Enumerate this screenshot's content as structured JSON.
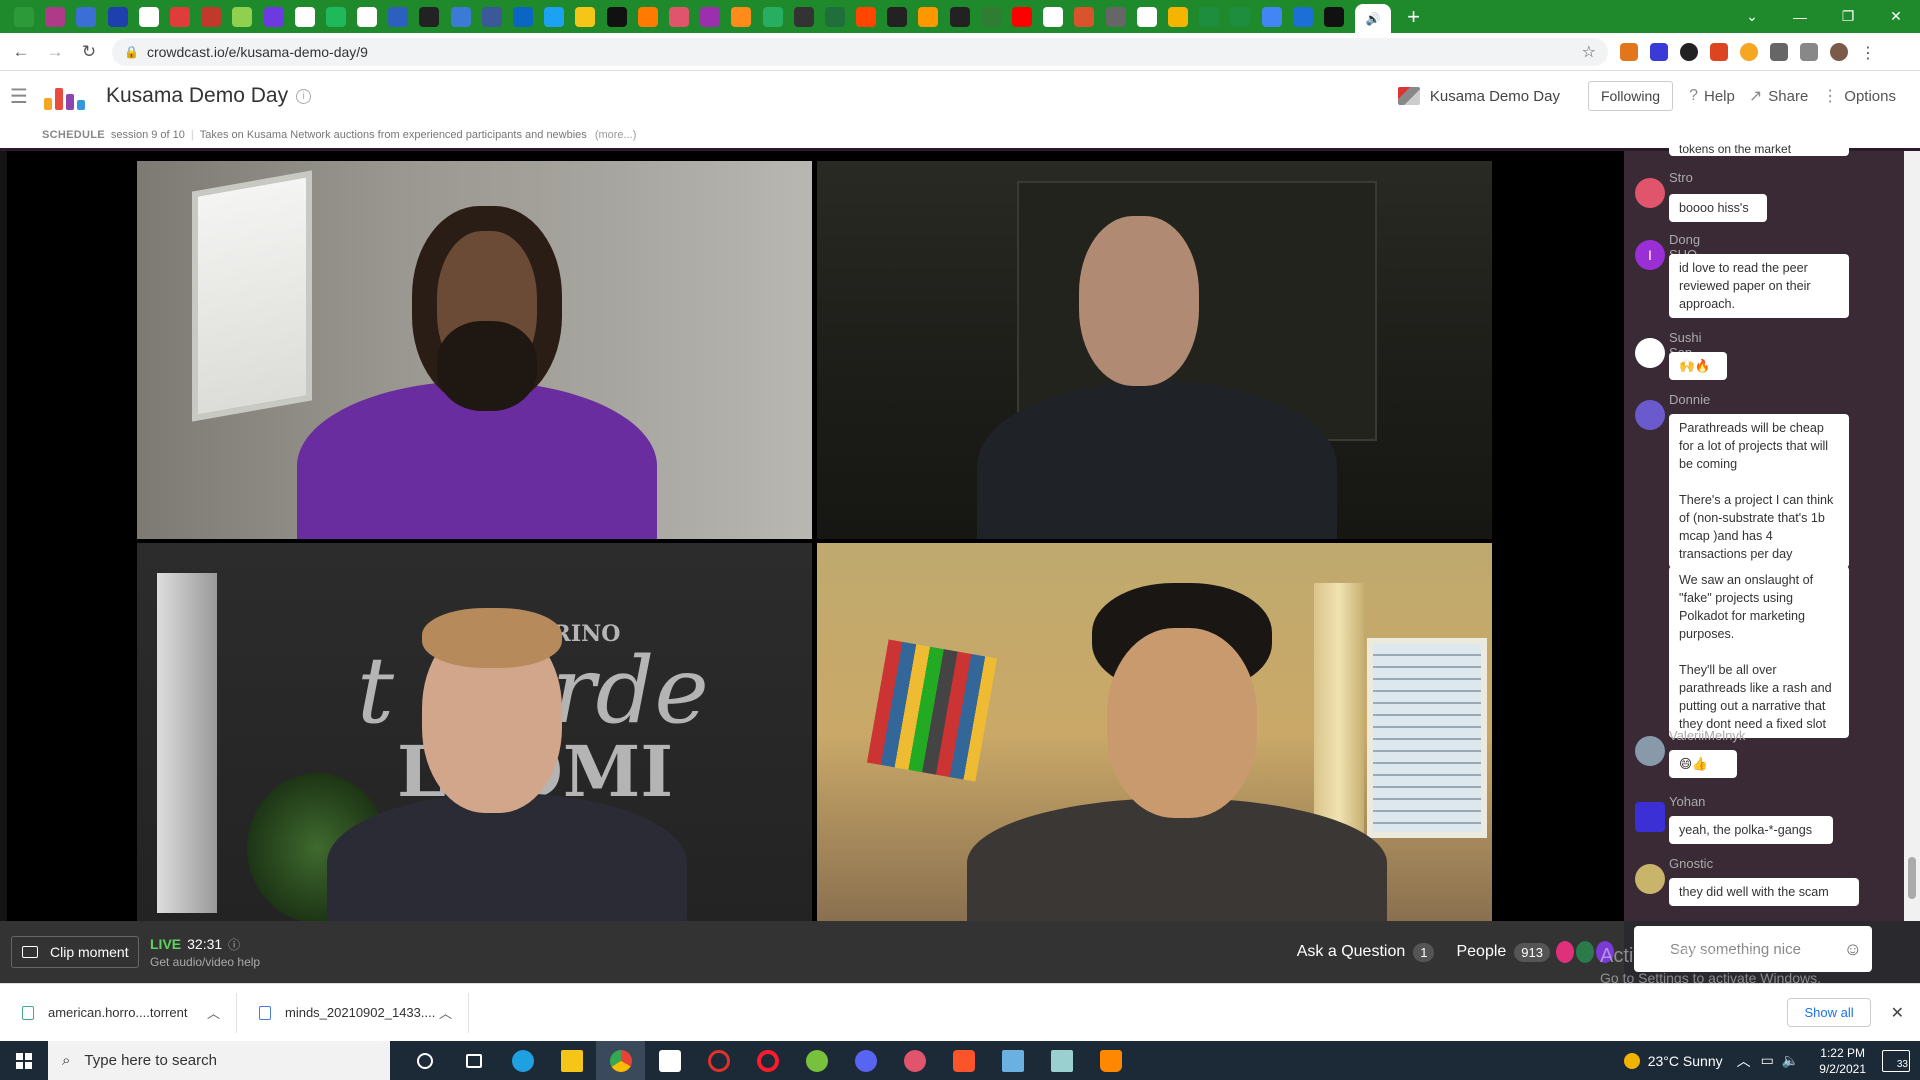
{
  "browser": {
    "url": "crowdcast.io/e/kusama-demo-day/9",
    "tab_colors": [
      "#2d9a3a",
      "#b03a8a",
      "#3b6fd6",
      "#1e3fae",
      "#ffffff",
      "#e03c3c",
      "#c0392b",
      "#8fd14f",
      "#6c3ae0",
      "#ffffff",
      "#1fb85a",
      "#ffffff",
      "#2d5fbf",
      "#222222",
      "#3b7bd6",
      "#3b5998",
      "#0a66c2",
      "#1da1f2",
      "#f5c518",
      "#111111",
      "#ff7a00",
      "#e0556b",
      "#9b2fae",
      "#ff8c1a",
      "#27ae60",
      "#333333",
      "#1f6f3a",
      "#ff4500",
      "#222222",
      "#ff9800",
      "#222222",
      "#2e7d32",
      "#ff0000",
      "#ffffff",
      "#d9532c",
      "#666666",
      "#ffffff",
      "#f4b400",
      "#1e8e3e",
      "#1e8e3e",
      "#4285f4",
      "#1b6fd6",
      "#111111"
    ]
  },
  "header": {
    "title": "Kusama Demo Day",
    "event_name": "Kusama Demo Day",
    "following_label": "Following",
    "help_label": "Help",
    "share_label": "Share",
    "options_label": "Options"
  },
  "schedule": {
    "label": "SCHEDULE",
    "session": "session 9 of 10",
    "description": "Takes on Kusama Network auctions from experienced participants and newbies",
    "more": "(more...)"
  },
  "video": {
    "chalk_text_top": "TORINO",
    "chalk_text_main": "t Garde",
    "chalk_text_bottom": "LCOMI"
  },
  "bottom_bar": {
    "clip_label": "Clip moment",
    "live_label": "LIVE",
    "live_time": "32:31",
    "av_help": "Get audio/video help",
    "ask_label": "Ask a Question",
    "ask_count": "1",
    "people_label": "People",
    "people_count": "913"
  },
  "chat": {
    "partial_text": "tokens on the market",
    "messages": [
      {
        "name": "Stro",
        "text": "boooo hiss's",
        "color": "#e0556b"
      },
      {
        "name": "Dong SHO",
        "text": "id love to read the peer reviewed paper on their approach.",
        "color": "#9b2fd6",
        "initial": "I"
      },
      {
        "name": "Sushi San",
        "text": "🙌🔥",
        "color": "#ffffff"
      },
      {
        "name": "Donnie",
        "text": "Parathreads will be cheap for a lot of projects that will be coming\n\nThere's a project I can think of (non-substrate that's 1b mcap )and has 4 transactions per day",
        "color": "#6a5acd"
      },
      {
        "name": "",
        "text": "We saw an onslaught of \"fake\" projects using Polkadot for marketing purposes.\n\nThey'll be all over parathreads like a rash and putting out a narrative that they dont need a fixed slot",
        "color": ""
      },
      {
        "name": "ValeriiMelnyk",
        "text": "😄👍",
        "color": "#8899aa"
      },
      {
        "name": "Yohan",
        "text": "yeah, the polka-*-gangs",
        "color": "#3b2fd6"
      },
      {
        "name": "Gnostic",
        "text": "they did well with the scam",
        "color": "#c8b46a"
      }
    ],
    "input_placeholder": "Say something nice"
  },
  "watermark": {
    "line1": "Activate Windows",
    "line2": "Go to Settings to activate Windows."
  },
  "downloads": {
    "items": [
      "american.horro....torrent",
      "minds_20210902_1433...."
    ],
    "show_all": "Show all"
  },
  "taskbar": {
    "search_placeholder": "Type here to search",
    "weather": "23°C  Sunny",
    "time": "1:22 PM",
    "date": "9/2/2021",
    "notifications": "33"
  }
}
